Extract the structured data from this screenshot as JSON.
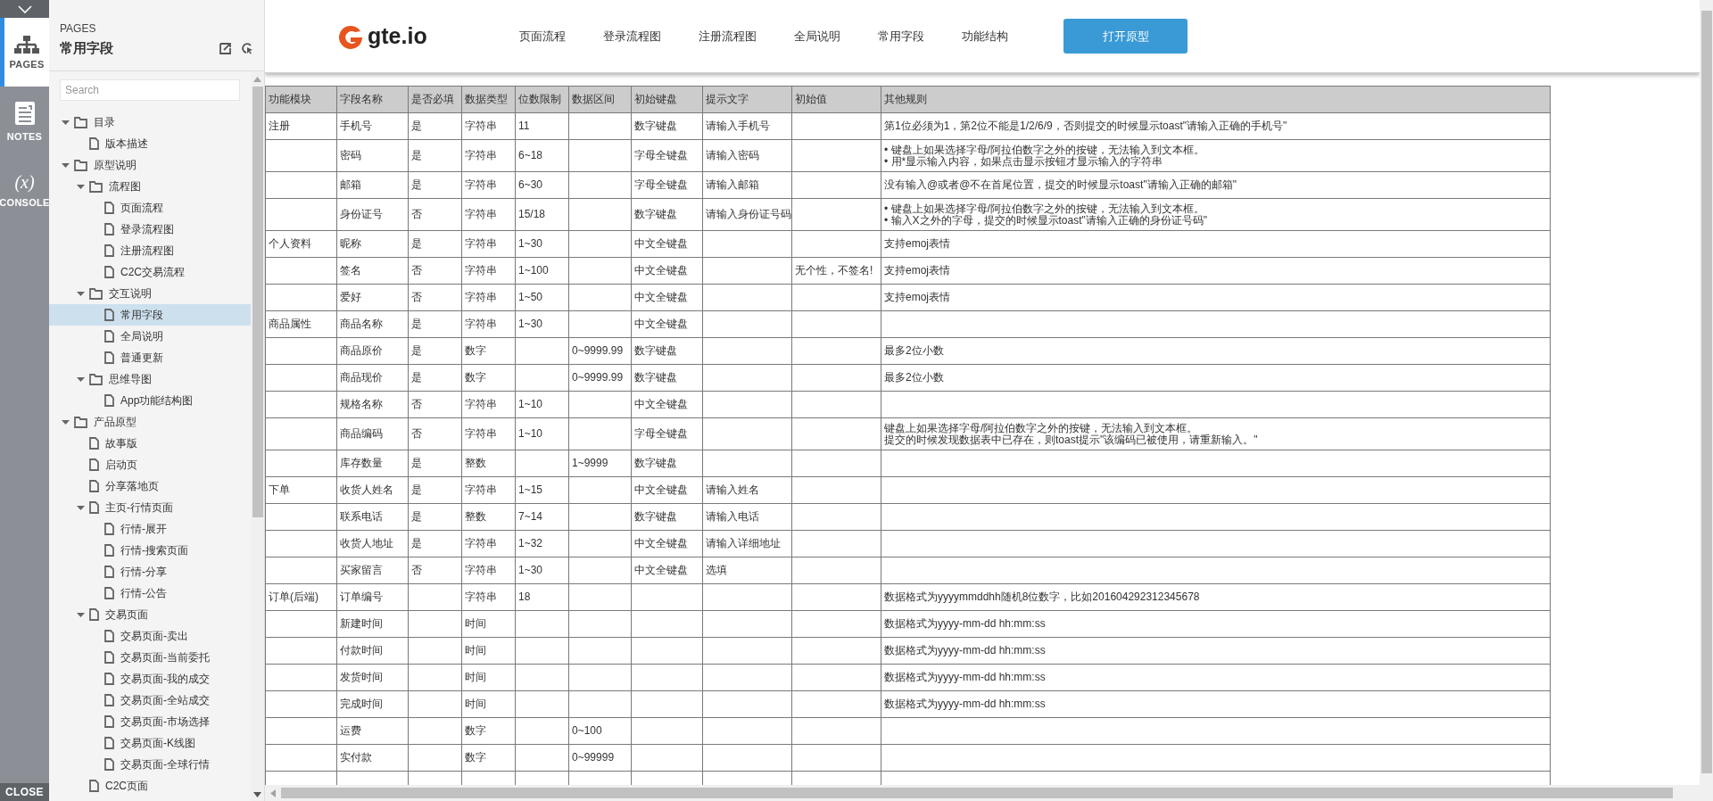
{
  "side_tabs": [
    {
      "kind": "pages",
      "label": "PAGES",
      "selected": true
    },
    {
      "kind": "notes",
      "label": "NOTES",
      "selected": false
    },
    {
      "kind": "console",
      "glyph": "(x)",
      "label": "CONSOLE",
      "selected": false
    }
  ],
  "close_button": "CLOSE",
  "pages_panel": {
    "caption": "PAGES",
    "title": "常用字段",
    "search": {
      "placeholder": "Search"
    },
    "tree": [
      {
        "kind": "folder",
        "label": "目录",
        "expanded": true,
        "selected": false,
        "children": [
          {
            "kind": "page",
            "label": "版本描述",
            "selected": false
          }
        ]
      },
      {
        "kind": "folder",
        "label": "原型说明",
        "expanded": true,
        "selected": false,
        "children": [
          {
            "kind": "folder",
            "label": "流程图",
            "expanded": true,
            "selected": false,
            "children": [
              {
                "kind": "page",
                "label": "页面流程",
                "selected": false
              },
              {
                "kind": "page",
                "label": "登录流程图",
                "selected": false
              },
              {
                "kind": "page",
                "label": "注册流程图",
                "selected": false
              },
              {
                "kind": "page",
                "label": "C2C交易流程",
                "selected": false
              }
            ]
          },
          {
            "kind": "folder",
            "label": "交互说明",
            "expanded": true,
            "selected": false,
            "children": [
              {
                "kind": "page",
                "label": "常用字段",
                "selected": true
              },
              {
                "kind": "page",
                "label": "全局说明",
                "selected": false
              },
              {
                "kind": "page",
                "label": "普通更新",
                "selected": false
              }
            ]
          },
          {
            "kind": "folder",
            "label": "思维导图",
            "expanded": true,
            "selected": false,
            "children": [
              {
                "kind": "page",
                "label": "App功能结构图",
                "selected": false
              }
            ]
          }
        ]
      },
      {
        "kind": "folder",
        "label": "产品原型",
        "expanded": true,
        "selected": false,
        "children": [
          {
            "kind": "page",
            "label": "故事版",
            "selected": false
          },
          {
            "kind": "page",
            "label": "启动页",
            "selected": false
          },
          {
            "kind": "page",
            "label": "分享落地页",
            "selected": false
          },
          {
            "kind": "page",
            "label": "主页-行情页面",
            "expanded": true,
            "selected": false,
            "children": [
              {
                "kind": "page",
                "label": "行情-展开",
                "selected": false
              },
              {
                "kind": "page",
                "label": "行情-搜索页面",
                "selected": false
              },
              {
                "kind": "page",
                "label": "行情-分享",
                "selected": false
              },
              {
                "kind": "page",
                "label": "行情-公告",
                "selected": false
              }
            ]
          },
          {
            "kind": "page",
            "label": "交易页面",
            "expanded": true,
            "selected": false,
            "children": [
              {
                "kind": "page",
                "label": "交易页面-卖出",
                "selected": false
              },
              {
                "kind": "page",
                "label": "交易页面-当前委托",
                "selected": false
              },
              {
                "kind": "page",
                "label": "交易页面-我的成交",
                "selected": false
              },
              {
                "kind": "page",
                "label": "交易页面-全站成交",
                "selected": false
              },
              {
                "kind": "page",
                "label": "交易页面-市场选择",
                "selected": false
              },
              {
                "kind": "page",
                "label": "交易页面-K线图",
                "selected": false
              },
              {
                "kind": "page",
                "label": "交易页面-全球行情",
                "selected": false
              }
            ]
          },
          {
            "kind": "page",
            "label": "C2C页面",
            "selected": false
          }
        ]
      }
    ]
  },
  "header": {
    "logo": "gte.io",
    "nav": [
      "页面流程",
      "登录流程图",
      "注册流程图",
      "全局说明",
      "常用字段",
      "功能结构"
    ],
    "button": "打开原型"
  },
  "table": {
    "columns": [
      "功能模块",
      "字段名称",
      "是否必填",
      "数据类型",
      "位数限制",
      "数据区间",
      "初始键盘",
      "提示文字",
      "初始值",
      "其他规则"
    ],
    "rows": [
      {
        "module": "注册",
        "field": "手机号",
        "required": "是",
        "type": "字符串",
        "length": "11",
        "keyboard": "数字键盘",
        "hint": "请输入手机号",
        "rules": [
          "第1位必须为1，第2位不能是1/2/6/9，否则提交的时候显示toast\"请输入正确的手机号\""
        ]
      },
      {
        "field": "密码",
        "required": "是",
        "type": "字符串",
        "length": "6~18",
        "keyboard": "字母全键盘",
        "hint": "请输入密码",
        "rules": [
          "• 键盘上如果选择字母/阿拉伯数字之外的按键，无法输入到文本框。",
          "• 用*显示输入内容，如果点击显示按钮才显示输入的字符串"
        ]
      },
      {
        "field": "邮箱",
        "required": "是",
        "type": "字符串",
        "length": "6~30",
        "keyboard": "字母全键盘",
        "hint": "请输入邮箱",
        "rules": [
          "没有输入@或者@不在首尾位置，提交的时候显示toast\"请输入正确的邮箱\""
        ]
      },
      {
        "field": "身份证号",
        "required": "否",
        "type": "字符串",
        "length": "15/18",
        "keyboard": "数字键盘",
        "hint": "请输入身份证号码",
        "rules": [
          "• 键盘上如果选择字母/阿拉伯数字之外的按键，无法输入到文本框。",
          "• 输入X之外的字母，提交的时候显示toast\"请输入正确的身份证号码\""
        ]
      },
      {
        "module": "个人资料",
        "field": "昵称",
        "required": "是",
        "type": "字符串",
        "length": "1~30",
        "keyboard": "中文全键盘",
        "rules": [
          "支持emoj表情"
        ]
      },
      {
        "field": "签名",
        "required": "否",
        "type": "字符串",
        "length": "1~100",
        "keyboard": "中文全键盘",
        "initial": "无个性，不签名!",
        "rules": [
          "支持emoj表情"
        ]
      },
      {
        "field": "爱好",
        "required": "否",
        "type": "字符串",
        "length": "1~50",
        "keyboard": "中文全键盘",
        "rules": [
          "支持emoj表情"
        ]
      },
      {
        "module": "商品属性",
        "field": "商品名称",
        "required": "是",
        "type": "字符串",
        "length": "1~30",
        "keyboard": "中文全键盘"
      },
      {
        "field": "商品原价",
        "required": "是",
        "type": "数字",
        "range": "0~9999.99",
        "keyboard": "数字键盘",
        "rules": [
          "最多2位小数"
        ]
      },
      {
        "field": "商品现价",
        "required": "是",
        "type": "数字",
        "range": "0~9999.99",
        "keyboard": "数字键盘",
        "rules": [
          "最多2位小数"
        ]
      },
      {
        "field": "规格名称",
        "required": "否",
        "type": "字符串",
        "length": "1~10",
        "keyboard": "中文全键盘"
      },
      {
        "field": "商品编码",
        "required": "否",
        "type": "字符串",
        "length": "1~10",
        "keyboard": "字母全键盘",
        "rules": [
          "键盘上如果选择字母/阿拉伯数字之外的按键，无法输入到文本框。",
          "提交的时候发现数据表中已存在，则toast提示\"该编码已被使用，请重新输入。\""
        ]
      },
      {
        "field": "库存数量",
        "required": "是",
        "type": "整数",
        "range": "1~9999",
        "keyboard": "数字键盘"
      },
      {
        "module": "下单",
        "field": "收货人姓名",
        "required": "是",
        "type": "字符串",
        "length": "1~15",
        "keyboard": "中文全键盘",
        "hint": "请输入姓名"
      },
      {
        "field": "联系电话",
        "required": "是",
        "type": "整数",
        "length": "7~14",
        "keyboard": "数字键盘",
        "hint": "请输入电话"
      },
      {
        "field": "收货人地址",
        "required": "是",
        "type": "字符串",
        "length": "1~32",
        "keyboard": "中文全键盘",
        "hint": "请输入详细地址"
      },
      {
        "field": "买家留言",
        "required": "否",
        "type": "字符串",
        "length": "1~30",
        "keyboard": "中文全键盘",
        "hint": "选填"
      },
      {
        "module": "订单(后端)",
        "field": "订单编号",
        "type": "字符串",
        "length": "18",
        "rules": [
          "数据格式为yyyymmddhh随机8位数字，比如201604292312345678"
        ]
      },
      {
        "field": "新建时间",
        "type": "时间",
        "rules": [
          "数据格式为yyyy-mm-dd hh:mm:ss"
        ]
      },
      {
        "field": "付款时间",
        "type": "时间",
        "rules": [
          "数据格式为yyyy-mm-dd hh:mm:ss"
        ]
      },
      {
        "field": "发货时间",
        "type": "时间",
        "rules": [
          "数据格式为yyyy-mm-dd hh:mm:ss"
        ]
      },
      {
        "field": "完成时间",
        "type": "时间",
        "rules": [
          "数据格式为yyyy-mm-dd hh:mm:ss"
        ]
      },
      {
        "field": "运费",
        "type": "数字",
        "range": "0~100"
      },
      {
        "field": "实付款",
        "type": "数字",
        "range": "0~99999"
      }
    ]
  }
}
